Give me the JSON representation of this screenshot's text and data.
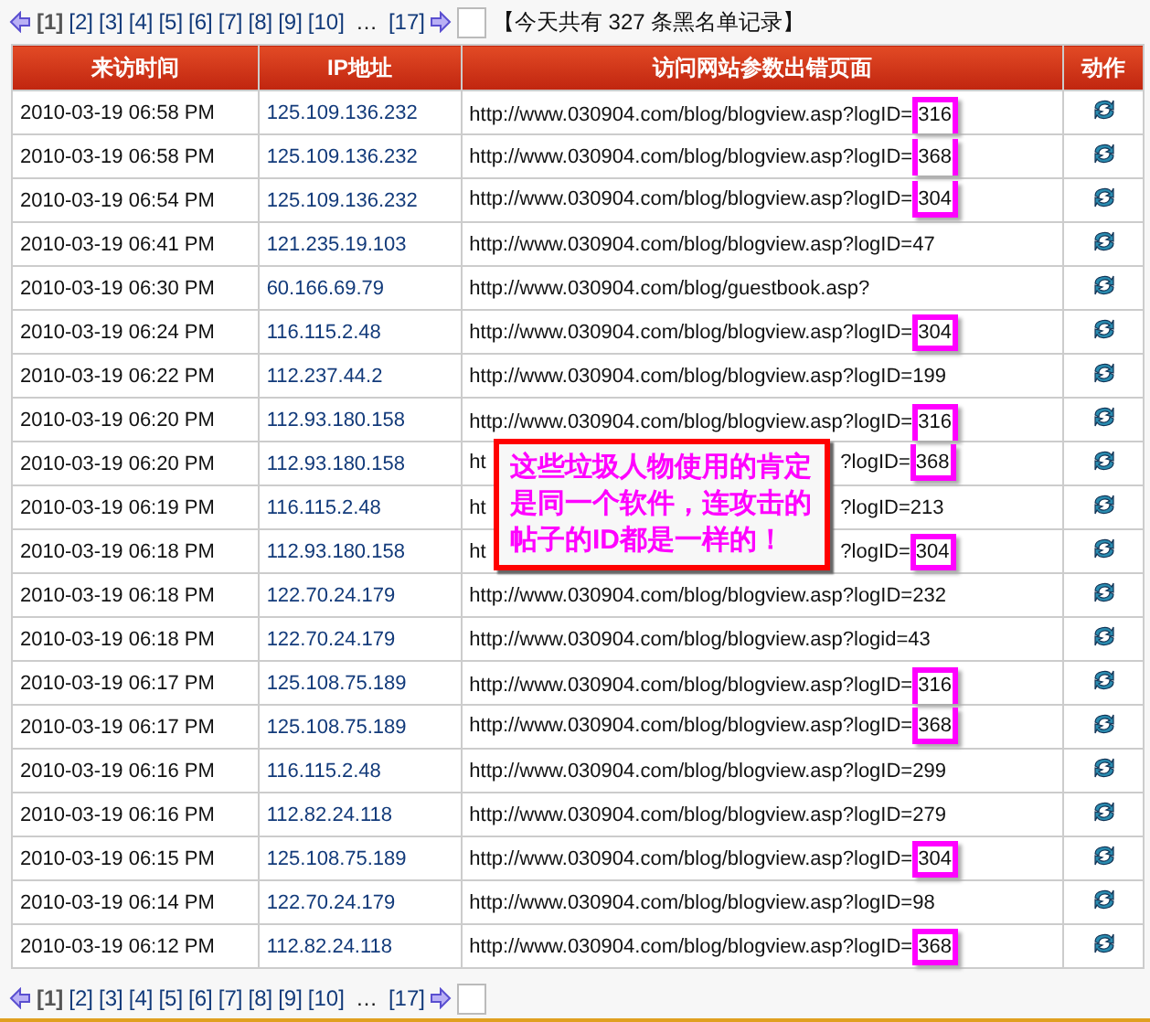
{
  "pager_top": {
    "pages": [
      {
        "label": "[1]",
        "selected": true
      },
      {
        "label": "[2]",
        "selected": false
      },
      {
        "label": "[3]",
        "selected": false
      },
      {
        "label": "[4]",
        "selected": false
      },
      {
        "label": "[5]",
        "selected": false
      },
      {
        "label": "[6]",
        "selected": false
      },
      {
        "label": "[7]",
        "selected": false
      },
      {
        "label": "[8]",
        "selected": false
      },
      {
        "label": "[9]",
        "selected": false
      },
      {
        "label": "[10]",
        "selected": false
      }
    ],
    "ellipsis": "…",
    "last": "[17]",
    "summary": "【今天共有 327 条黑名单记录】"
  },
  "table": {
    "columns": [
      "来访时间",
      "IP地址",
      "访问网站参数出错页面",
      "动作"
    ],
    "rows": [
      {
        "time": "2010-03-19 06:58 PM",
        "ip": "125.109.136.232",
        "url": "http://www.030904.com/blog/blogview.asp?logID=",
        "marked_id": "316"
      },
      {
        "time": "2010-03-19 06:58 PM",
        "ip": "125.109.136.232",
        "url": "http://www.030904.com/blog/blogview.asp?logID=",
        "marked_id": "368"
      },
      {
        "time": "2010-03-19 06:54 PM",
        "ip": "125.109.136.232",
        "url": "http://www.030904.com/blog/blogview.asp?logID=",
        "marked_id": "304"
      },
      {
        "time": "2010-03-19 06:41 PM",
        "ip": "121.235.19.103",
        "url": "http://www.030904.com/blog/blogview.asp?logID=47"
      },
      {
        "time": "2010-03-19 06:30 PM",
        "ip": "60.166.69.79",
        "url": "http://www.030904.com/blog/guestbook.asp?"
      },
      {
        "time": "2010-03-19 06:24 PM",
        "ip": "116.115.2.48",
        "url": "http://www.030904.com/blog/blogview.asp?logID=",
        "marked_id": "304"
      },
      {
        "time": "2010-03-19 06:22 PM",
        "ip": "112.237.44.2",
        "url": "http://www.030904.com/blog/blogview.asp?logID=199"
      },
      {
        "time": "2010-03-19 06:20 PM",
        "ip": "112.93.180.158",
        "url": "http://www.030904.com/blog/blogview.asp?logID=",
        "marked_id": "316"
      },
      {
        "time": "2010-03-19 06:20 PM",
        "ip": "112.93.180.158",
        "url": "ht",
        "url_tail": "?logID=",
        "marked_id": "368"
      },
      {
        "time": "2010-03-19 06:19 PM",
        "ip": "116.115.2.48",
        "url": "ht",
        "url_tail": "?logID=213"
      },
      {
        "time": "2010-03-19 06:18 PM",
        "ip": "112.93.180.158",
        "url": "ht",
        "url_tail": "?logID=",
        "marked_id": "304"
      },
      {
        "time": "2010-03-19 06:18 PM",
        "ip": "122.70.24.179",
        "url": "http://www.030904.com/blog/blogview.asp?logID=232"
      },
      {
        "time": "2010-03-19 06:18 PM",
        "ip": "122.70.24.179",
        "url": "http://www.030904.com/blog/blogview.asp?logid=43"
      },
      {
        "time": "2010-03-19 06:17 PM",
        "ip": "125.108.75.189",
        "url": "http://www.030904.com/blog/blogview.asp?logID=",
        "marked_id": "316"
      },
      {
        "time": "2010-03-19 06:17 PM",
        "ip": "125.108.75.189",
        "url": "http://www.030904.com/blog/blogview.asp?logID=",
        "marked_id": "368"
      },
      {
        "time": "2010-03-19 06:16 PM",
        "ip": "116.115.2.48",
        "url": "http://www.030904.com/blog/blogview.asp?logID=299"
      },
      {
        "time": "2010-03-19 06:16 PM",
        "ip": "112.82.24.118",
        "url": "http://www.030904.com/blog/blogview.asp?logID=279"
      },
      {
        "time": "2010-03-19 06:15 PM",
        "ip": "125.108.75.189",
        "url": "http://www.030904.com/blog/blogview.asp?logID=",
        "marked_id": "304"
      },
      {
        "time": "2010-03-19 06:14 PM",
        "ip": "122.70.24.179",
        "url": "http://www.030904.com/blog/blogview.asp?logID=98"
      },
      {
        "time": "2010-03-19 06:12 PM",
        "ip": "112.82.24.118",
        "url": "http://www.030904.com/blog/blogview.asp?logID=",
        "marked_id": "368"
      }
    ]
  },
  "callout": {
    "text": "这些垃圾人物使用的肯定是同一个软件，连攻击的帖子的ID都是一样的！"
  },
  "pager_bottom": {
    "pages": [
      {
        "label": "[1]",
        "selected": true
      },
      {
        "label": "[2]",
        "selected": false
      },
      {
        "label": "[3]",
        "selected": false
      },
      {
        "label": "[4]",
        "selected": false
      },
      {
        "label": "[5]",
        "selected": false
      },
      {
        "label": "[6]",
        "selected": false
      },
      {
        "label": "[7]",
        "selected": false
      },
      {
        "label": "[8]",
        "selected": false
      },
      {
        "label": "[9]",
        "selected": false
      },
      {
        "label": "[10]",
        "selected": false
      }
    ],
    "ellipsis": "…",
    "last": "[17]"
  }
}
